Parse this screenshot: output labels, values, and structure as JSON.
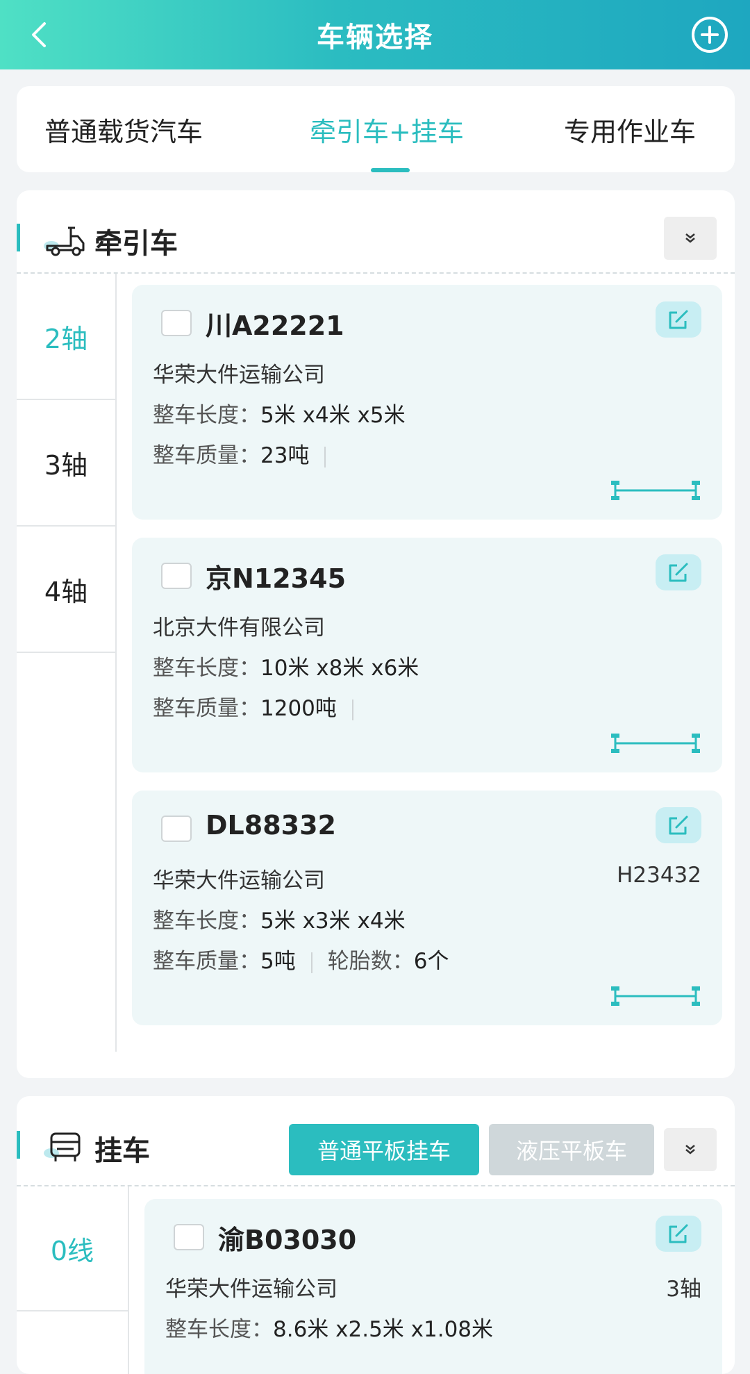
{
  "header": {
    "title": "车辆选择"
  },
  "tabs": [
    {
      "label": "普通载货汽车"
    },
    {
      "label": "牵引车+挂车"
    },
    {
      "label": "专用作业车"
    }
  ],
  "tractor": {
    "title": "牵引车",
    "axles": [
      "2轴",
      "3轴",
      "4轴"
    ],
    "vehicles": [
      {
        "plate": "川A22221",
        "company": "华荣大件运输公司",
        "length_label": "整车长度：",
        "length": "5米 x4米 x5米",
        "mass_label": "整车质量：",
        "mass": "23吨"
      },
      {
        "plate": "京N12345",
        "company": "北京大件有限公司",
        "length_label": "整车长度：",
        "length": "10米 x8米 x6米",
        "mass_label": "整车质量：",
        "mass": "1200吨"
      },
      {
        "plate": "DL88332",
        "company": "华荣大件运输公司",
        "extra": "H23432",
        "length_label": "整车长度：",
        "length": "5米 x3米 x4米",
        "mass_label": "整车质量：",
        "mass": "5吨",
        "tire_label": "轮胎数：",
        "tires": "6个"
      }
    ]
  },
  "trailer": {
    "title": "挂车",
    "type_buttons": [
      "普通平板挂车",
      "液压平板车"
    ],
    "lines": [
      "0线"
    ],
    "vehicles": [
      {
        "plate": "渝B03030",
        "company": "华荣大件运输公司",
        "extra": "3轴",
        "length_label": "整车长度：",
        "length": "8.6米 x2.5米 x1.08米"
      }
    ]
  },
  "colors": {
    "accent": "#2bbdbf",
    "card_bg": "#eef7f8"
  }
}
